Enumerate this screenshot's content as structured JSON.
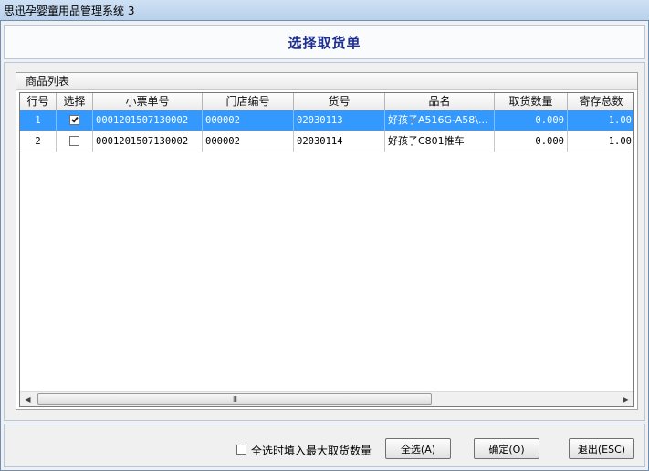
{
  "window": {
    "app_title": "思迅孕婴童用品管理系统 3",
    "dialog_title": "选择取货单"
  },
  "product_list": {
    "group_title": "商品列表",
    "columns": [
      "行号",
      "选择",
      "小票单号",
      "门店编号",
      "货号",
      "品名",
      "取货数量",
      "寄存总数"
    ],
    "rows": [
      {
        "line_no": "1",
        "checked": true,
        "receipt_no": "0001201507130002",
        "store_no": "000002",
        "item_no": "02030113",
        "product_name": "好孩子A516G-A58\\...",
        "pickup_qty": "0.000",
        "stored_total": "1.00",
        "selected": true
      },
      {
        "line_no": "2",
        "checked": false,
        "receipt_no": "0001201507130002",
        "store_no": "000002",
        "item_no": "02030114",
        "product_name": "好孩子C801推车",
        "pickup_qty": "0.000",
        "stored_total": "1.00",
        "selected": false
      }
    ],
    "scrollbar_grip": "III"
  },
  "footer": {
    "fill_max_label": "全选时填入最大取货数量",
    "fill_max_checked": false,
    "select_all_label": "全选(A)",
    "ok_label": "确定(O)",
    "exit_label": "退出(ESC)"
  },
  "colors": {
    "selection": "#3399ff",
    "title_text": "#1f2f8e"
  }
}
